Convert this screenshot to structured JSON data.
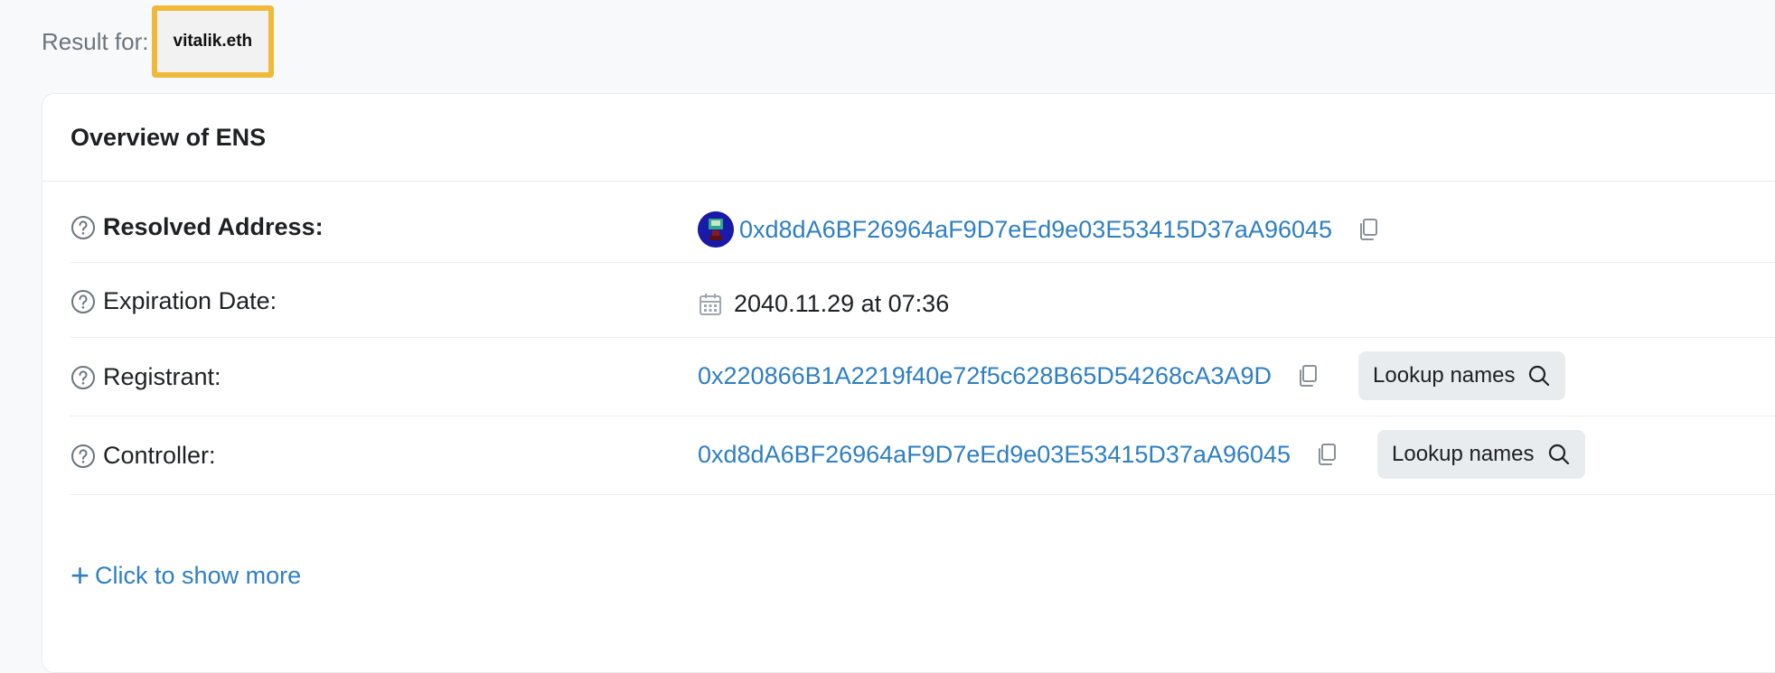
{
  "result": {
    "label": "Result for:",
    "query": "vitalik.eth",
    "highlight_color": "#f0b93a"
  },
  "card": {
    "title": "Overview of ENS",
    "rows": [
      {
        "label": "Resolved Address:",
        "value": "0xd8dA6BF26964aF9D7eEd9e03E53415D37aA96045"
      },
      {
        "label": "Expiration Date:",
        "value": "2040.11.29 at 07:36"
      },
      {
        "label": "Registrant:",
        "value": "0x220866B1A2219f40e72f5c628B65D54268cA3A9D",
        "button": "Lookup names"
      },
      {
        "label": "Controller:",
        "value": "0xd8dA6BF26964aF9D7eEd9e03E53415D37aA96045",
        "button": "Lookup names"
      }
    ],
    "show_more": "Click to show more"
  },
  "colors": {
    "link": "#2f7fc1",
    "avatar": "#1a1aa8"
  },
  "icons": [
    "help-icon",
    "copy-icon",
    "calendar-icon",
    "search-icon",
    "plus-icon",
    "avatar"
  ]
}
